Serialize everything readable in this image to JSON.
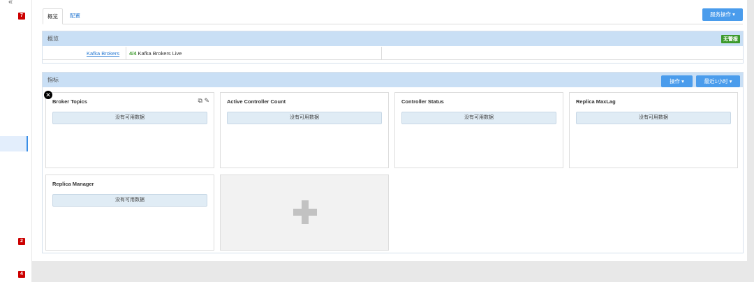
{
  "sidebar": {
    "collapse_glyph": "«",
    "badges": [
      "7",
      "2",
      "4"
    ]
  },
  "tabs": [
    {
      "label": "概览"
    },
    {
      "label": "配置"
    }
  ],
  "service_actions_label": "服务操作 ▾",
  "overview": {
    "title": "概览",
    "alarm_badge": "无警报",
    "link": "Kafka Brokers",
    "live_count": "4/4",
    "live_text": " Kafka Brokers Live"
  },
  "metrics": {
    "title": "指标",
    "actions_label": "操作 ▾",
    "range_label": "最近1小时 ▾",
    "widgets": [
      {
        "title": "Broker Topics",
        "nodata": "没有可用数据"
      },
      {
        "title": "Active Controller Count",
        "nodata": "没有可用数据"
      },
      {
        "title": "Controller Status",
        "nodata": "没有可用数据"
      },
      {
        "title": "Replica MaxLag",
        "nodata": "没有可用数据"
      },
      {
        "title": "Replica Manager",
        "nodata": "没有可用数据"
      }
    ]
  },
  "icons": {
    "close": "close-circle-icon",
    "copy": "copy-icon",
    "edit": "edit-icon",
    "add": "plus-icon"
  },
  "colors": {
    "accent": "#4a9cec",
    "panel_header": "#c9dff5",
    "alarm_ok": "#3c9a2b",
    "badge": "#cc0000",
    "link": "#2a7bd3"
  }
}
